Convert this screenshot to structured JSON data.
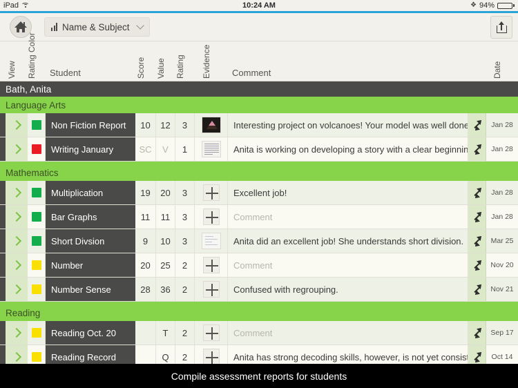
{
  "status_bar": {
    "device": "iPad",
    "wifi_icon": "wifi-icon",
    "time": "10:24 AM",
    "bluetooth_icon": "bluetooth-icon",
    "battery_percent": "94%",
    "battery_icon": "battery-icon"
  },
  "toolbar": {
    "home_icon": "home-icon",
    "chart_icon": "bar-chart-icon",
    "sort_selector_label": "Name & Subject",
    "chevron_icon": "chevron-down-icon",
    "share_icon": "share-icon"
  },
  "columns": {
    "view": "View",
    "rating_color": "Rating Color",
    "student": "Student",
    "score": "Score",
    "value": "Value",
    "rating": "Rating",
    "evidence": "Evidence",
    "comment": "Comment",
    "date": "Date"
  },
  "student_name": "Bath, Anita",
  "comment_placeholder": "Comment",
  "colors": {
    "accent_blue": "#2aa3d6",
    "subject_green": "#87d44b",
    "swatch_green": "#13ae4b",
    "swatch_red": "#ec1c24",
    "swatch_yellow": "#f9e000",
    "student_dark": "#4a4a48"
  },
  "sections": [
    {
      "title": "Language Arts",
      "rows": [
        {
          "expand_icon": "chevron-right-icon",
          "swatch": "#13ae4b",
          "student": "Non Fiction Report",
          "score": "10",
          "value": "12",
          "rating": "3",
          "evidence_icon": "photo-thumbnail",
          "evidence_kind": "volcano",
          "comment": "Interesting project on volcanoes! Your model was well done and",
          "comment_is_placeholder": false,
          "date": "Jan 28"
        },
        {
          "expand_icon": "chevron-right-icon",
          "swatch": "#ec1c24",
          "student": "Writing January",
          "score": "SC",
          "value": "V",
          "rating": "1",
          "score_muted": true,
          "evidence_icon": "document-thumbnail",
          "evidence_kind": "doc",
          "comment": "Anita is working on developing a story with a clear beginning,",
          "comment_is_placeholder": false,
          "date": "Jan 28"
        }
      ]
    },
    {
      "title": "Mathematics",
      "rows": [
        {
          "expand_icon": "chevron-right-icon",
          "swatch": "#13ae4b",
          "student": "Multiplication",
          "score": "19",
          "value": "20",
          "rating": "3",
          "evidence_icon": "add-evidence-icon",
          "evidence_kind": "plus",
          "comment": "Excellent job!",
          "comment_is_placeholder": false,
          "date": "Jan 28"
        },
        {
          "expand_icon": "chevron-right-icon",
          "swatch": "#13ae4b",
          "student": "Bar Graphs",
          "score": "11",
          "value": "11",
          "rating": "3",
          "evidence_icon": "add-evidence-icon",
          "evidence_kind": "plus",
          "comment": "Comment",
          "comment_is_placeholder": true,
          "date": "Jan 28"
        },
        {
          "expand_icon": "chevron-right-icon",
          "swatch": "#13ae4b",
          "student": "Short Divsion",
          "score": "9",
          "value": "10",
          "rating": "3",
          "evidence_icon": "scan-thumbnail",
          "evidence_kind": "scan",
          "comment": "Anita did an excellent job! She understands short division.",
          "comment_is_placeholder": false,
          "date": "Mar 25"
        },
        {
          "expand_icon": "chevron-right-icon",
          "swatch": "#f9e000",
          "student": "Number",
          "score": "20",
          "value": "25",
          "rating": "2",
          "evidence_icon": "add-evidence-icon",
          "evidence_kind": "plus",
          "comment": "Comment",
          "comment_is_placeholder": true,
          "date": "Nov 20"
        },
        {
          "expand_icon": "chevron-right-icon",
          "swatch": "#f9e000",
          "student": "Number Sense",
          "score": "28",
          "value": "36",
          "rating": "2",
          "evidence_icon": "add-evidence-icon",
          "evidence_kind": "plus",
          "comment": "Confused with regrouping.",
          "comment_is_placeholder": false,
          "date": "Nov 21"
        }
      ]
    },
    {
      "title": "Reading",
      "rows": [
        {
          "expand_icon": "chevron-right-icon",
          "swatch": "#f9e000",
          "student": "Reading Oct. 20",
          "score": "",
          "value": "T",
          "rating": "2",
          "evidence_icon": "add-evidence-icon",
          "evidence_kind": "plus",
          "comment": "Comment",
          "comment_is_placeholder": true,
          "date": "Sep 17"
        },
        {
          "expand_icon": "chevron-right-icon",
          "swatch": "#f9e000",
          "student": "Reading Record",
          "score": "",
          "value": "Q",
          "rating": "2",
          "evidence_icon": "add-evidence-icon",
          "evidence_kind": "plus",
          "comment": "Anita has strong decoding skills, however, is not yet consistently",
          "comment_is_placeholder": false,
          "date": "Oct 14"
        },
        {
          "expand_icon": "chevron-right-icon",
          "swatch": "#f9e000",
          "student": "",
          "score": "",
          "value": "",
          "rating": "",
          "evidence_icon": "add-evidence-icon",
          "evidence_kind": "plus",
          "comment": "",
          "comment_is_placeholder": true,
          "date": "",
          "partial": true
        }
      ]
    }
  ],
  "caption": "Compile assessment reports for students"
}
